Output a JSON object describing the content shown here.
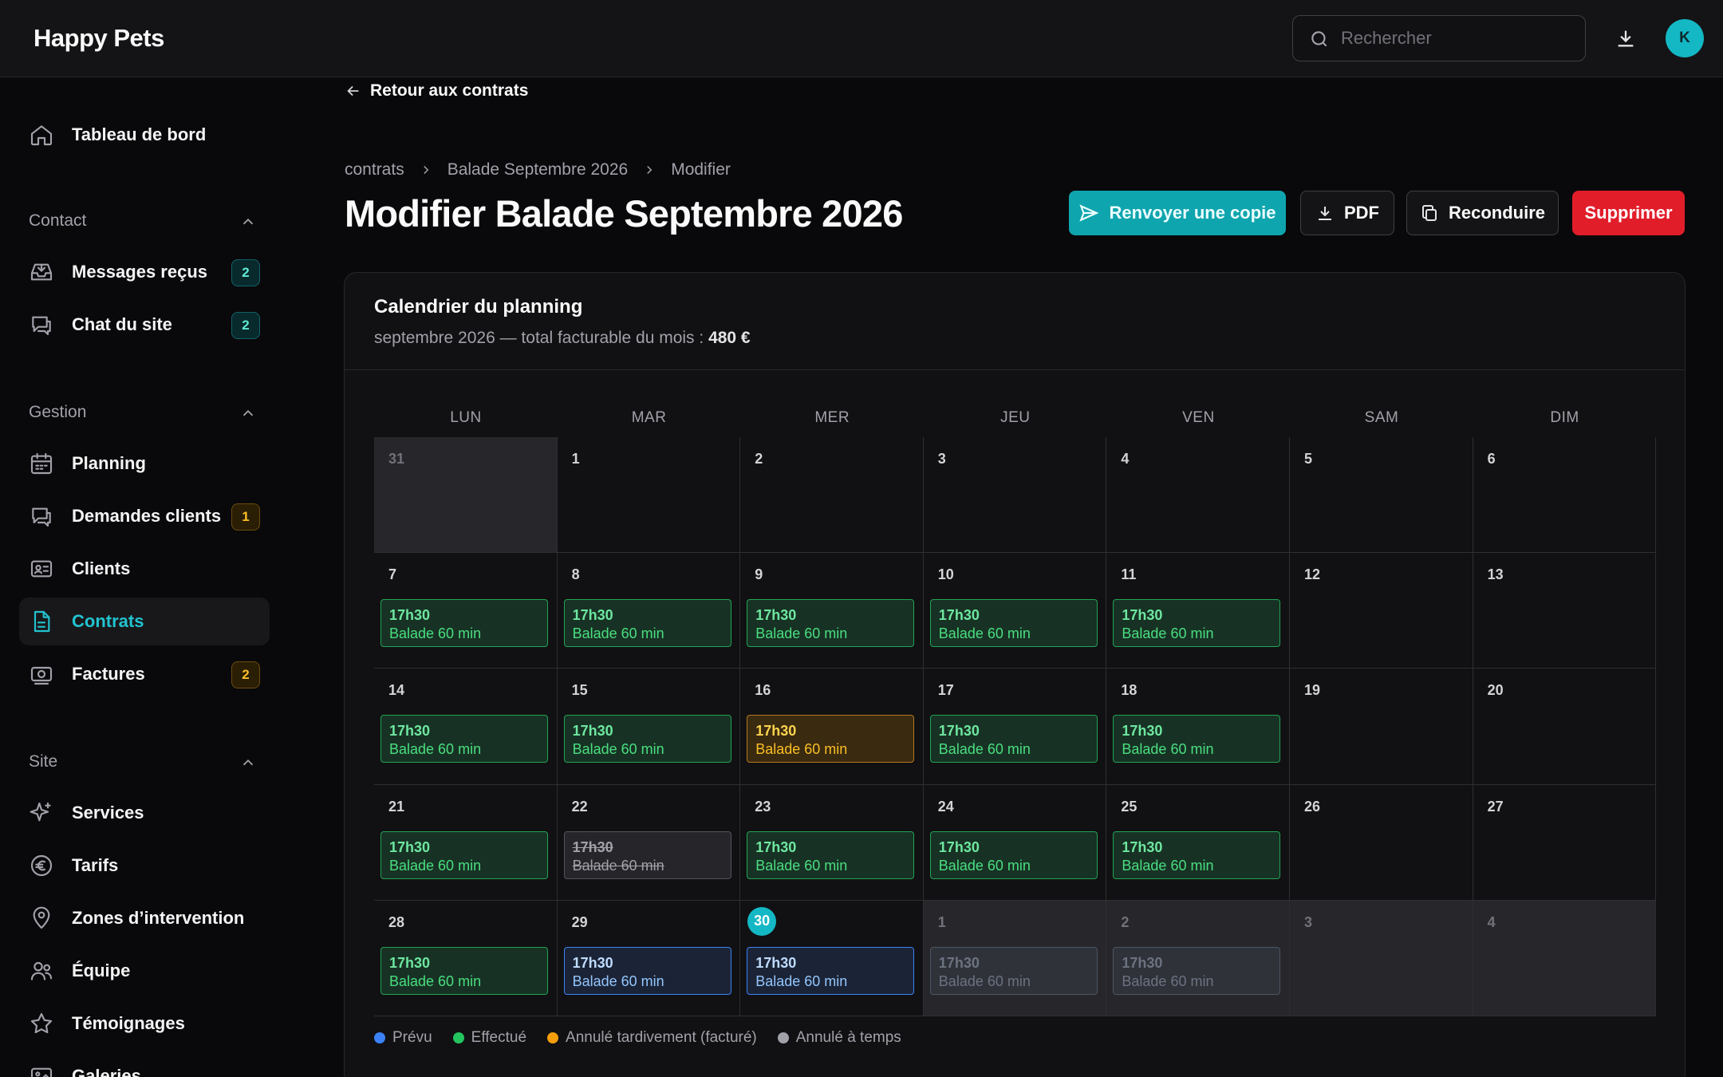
{
  "app": {
    "brand": "Happy Pets",
    "avatar_initial": "K"
  },
  "search": {
    "placeholder": "Rechercher"
  },
  "sidebar": {
    "top": {
      "label": "Tableau de bord",
      "icon": "home-icon"
    },
    "sections": [
      {
        "title": "Contact",
        "items": [
          {
            "label": "Messages reçus",
            "badge": "2",
            "badge_color": "teal",
            "icon": "inbox-icon"
          },
          {
            "label": "Chat du site",
            "badge": "2",
            "badge_color": "teal",
            "icon": "chat-icon"
          }
        ]
      },
      {
        "title": "Gestion",
        "items": [
          {
            "label": "Planning",
            "badge": "",
            "icon": "calendar-icon"
          },
          {
            "label": "Demandes clients",
            "badge": "1",
            "badge_color": "amber",
            "icon": "chat-icon"
          },
          {
            "label": "Clients",
            "badge": "",
            "icon": "id-card-icon"
          },
          {
            "label": "Contrats",
            "badge": "",
            "icon": "document-icon",
            "active": true
          },
          {
            "label": "Factures",
            "badge": "2",
            "badge_color": "amber",
            "icon": "banknote-icon"
          }
        ]
      },
      {
        "title": "Site",
        "items": [
          {
            "label": "Services",
            "badge": "",
            "icon": "sparkles-icon"
          },
          {
            "label": "Tarifs",
            "badge": "",
            "icon": "euro-icon"
          },
          {
            "label": "Zones d’intervention",
            "badge": "",
            "icon": "map-pin-icon"
          },
          {
            "label": "Équipe",
            "badge": "",
            "icon": "users-icon"
          },
          {
            "label": "Témoignages",
            "badge": "",
            "icon": "star-icon"
          },
          {
            "label": "Galeries",
            "badge": "",
            "icon": "image-icon"
          }
        ]
      }
    ]
  },
  "main": {
    "back_label": "Retour aux contrats",
    "breadcrumb": [
      "contrats",
      "Balade Septembre 2026",
      "Modifier"
    ],
    "title": "Modifier Balade Septembre 2026",
    "actions": {
      "resend": "Renvoyer une copie",
      "pdf": "PDF",
      "renew": "Reconduire",
      "delete": "Supprimer"
    }
  },
  "calendar": {
    "title": "Calendrier du planning",
    "subtitle_prefix": "septembre 2026 — total facturable du mois : ",
    "subtitle_total": "480 €",
    "weekdays": [
      "LUN",
      "MAR",
      "MER",
      "JEU",
      "VEN",
      "SAM",
      "DIM"
    ],
    "weeks": [
      [
        {
          "day": "31",
          "out": true
        },
        {
          "day": "1"
        },
        {
          "day": "2"
        },
        {
          "day": "3"
        },
        {
          "day": "4"
        },
        {
          "day": "5"
        },
        {
          "day": "6"
        }
      ],
      [
        {
          "day": "7",
          "ev": {
            "time": "17h30",
            "label": "Balade 60 min",
            "status": "done"
          }
        },
        {
          "day": "8",
          "ev": {
            "time": "17h30",
            "label": "Balade 60 min",
            "status": "done"
          }
        },
        {
          "day": "9",
          "ev": {
            "time": "17h30",
            "label": "Balade 60 min",
            "status": "done"
          }
        },
        {
          "day": "10",
          "ev": {
            "time": "17h30",
            "label": "Balade 60 min",
            "status": "done"
          }
        },
        {
          "day": "11",
          "ev": {
            "time": "17h30",
            "label": "Balade 60 min",
            "status": "done"
          }
        },
        {
          "day": "12"
        },
        {
          "day": "13"
        }
      ],
      [
        {
          "day": "14",
          "ev": {
            "time": "17h30",
            "label": "Balade 60 min",
            "status": "done"
          }
        },
        {
          "day": "15",
          "ev": {
            "time": "17h30",
            "label": "Balade 60 min",
            "status": "done"
          }
        },
        {
          "day": "16",
          "ev": {
            "time": "17h30",
            "label": "Balade 60 min",
            "status": "late"
          }
        },
        {
          "day": "17",
          "ev": {
            "time": "17h30",
            "label": "Balade 60 min",
            "status": "done"
          }
        },
        {
          "day": "18",
          "ev": {
            "time": "17h30",
            "label": "Balade 60 min",
            "status": "done"
          }
        },
        {
          "day": "19"
        },
        {
          "day": "20"
        }
      ],
      [
        {
          "day": "21",
          "ev": {
            "time": "17h30",
            "label": "Balade 60 min",
            "status": "done"
          }
        },
        {
          "day": "22",
          "ev": {
            "time": "17h30",
            "label": "Balade 60 min",
            "status": "ontime"
          }
        },
        {
          "day": "23",
          "ev": {
            "time": "17h30",
            "label": "Balade 60 min",
            "status": "done"
          }
        },
        {
          "day": "24",
          "ev": {
            "time": "17h30",
            "label": "Balade 60 min",
            "status": "done"
          }
        },
        {
          "day": "25",
          "ev": {
            "time": "17h30",
            "label": "Balade 60 min",
            "status": "done"
          }
        },
        {
          "day": "26"
        },
        {
          "day": "27"
        }
      ],
      [
        {
          "day": "28",
          "ev": {
            "time": "17h30",
            "label": "Balade 60 min",
            "status": "done"
          }
        },
        {
          "day": "29",
          "ev": {
            "time": "17h30",
            "label": "Balade 60 min",
            "status": "planned"
          }
        },
        {
          "day": "30",
          "today": true,
          "ev": {
            "time": "17h30",
            "label": "Balade 60 min",
            "status": "planned"
          }
        },
        {
          "day": "1",
          "out": true,
          "ev": {
            "time": "17h30",
            "label": "Balade 60 min",
            "status": "planned-dim"
          }
        },
        {
          "day": "2",
          "out": true,
          "ev": {
            "time": "17h30",
            "label": "Balade 60 min",
            "status": "planned-dim"
          }
        },
        {
          "day": "3",
          "out": true
        },
        {
          "day": "4",
          "out": true
        }
      ]
    ],
    "legend": [
      {
        "label": "Prévu",
        "color": "#3b82f6"
      },
      {
        "label": "Effectué",
        "color": "#22c55e"
      },
      {
        "label": "Annulé tardivement (facturé)",
        "color": "#f59e0b"
      },
      {
        "label": "Annulé à temps",
        "color": "#a1a1aa"
      }
    ]
  }
}
